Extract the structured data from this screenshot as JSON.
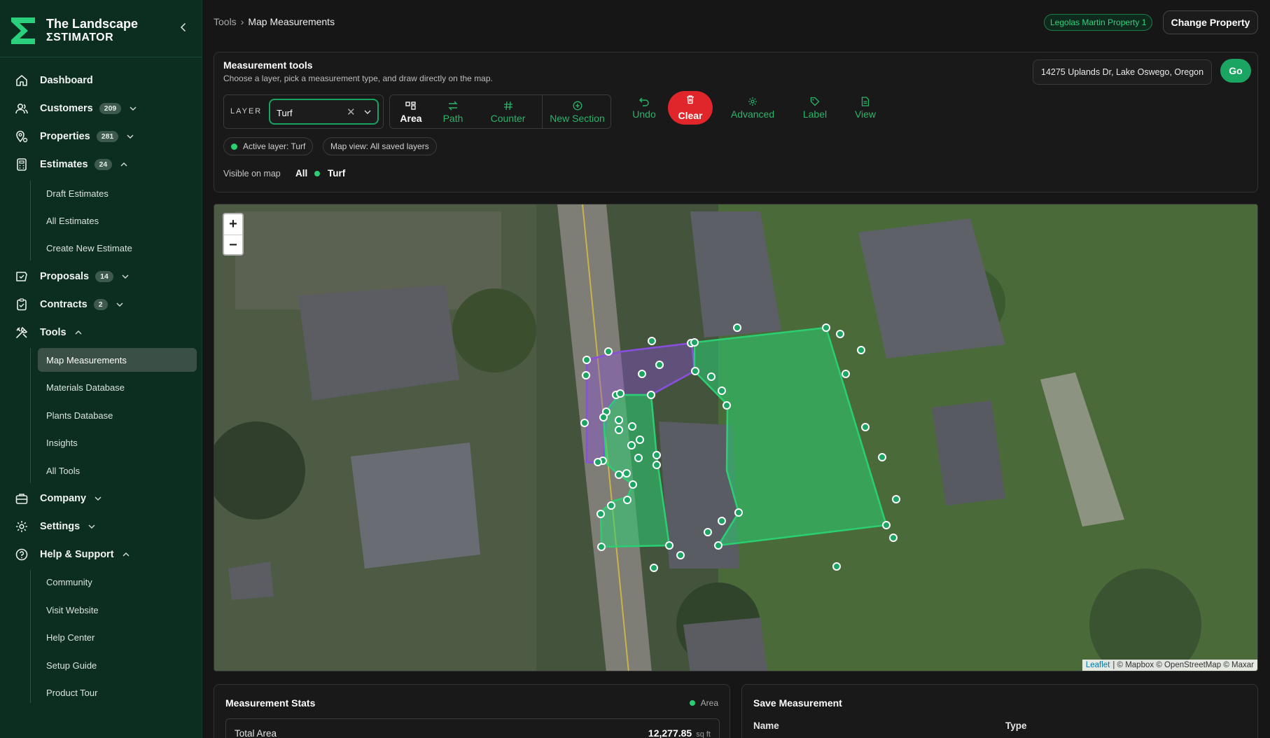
{
  "brand": {
    "line1": "The Landscape",
    "line2": "ΣSTIMATOR",
    "collapse_icon": "‹"
  },
  "nav": {
    "dashboard": {
      "label": "Dashboard"
    },
    "customers": {
      "label": "Customers",
      "badge": "209"
    },
    "properties": {
      "label": "Properties",
      "badge": "281"
    },
    "estimates": {
      "label": "Estimates",
      "badge": "24"
    },
    "estimates_sub": [
      "Draft Estimates",
      "All Estimates",
      "Create New Estimate"
    ],
    "proposals": {
      "label": "Proposals",
      "badge": "14"
    },
    "contracts": {
      "label": "Contracts",
      "badge": "2"
    },
    "tools": {
      "label": "Tools"
    },
    "tools_sub": [
      "Map Measurements",
      "Materials Database",
      "Plants Database",
      "Insights",
      "All Tools"
    ],
    "company": {
      "label": "Company"
    },
    "settings": {
      "label": "Settings"
    },
    "help": {
      "label": "Help & Support"
    },
    "help_sub": [
      "Community",
      "Visit Website",
      "Help Center",
      "Setup Guide",
      "Product Tour"
    ]
  },
  "breadcrumb": {
    "parent": "Tools",
    "separator": "›",
    "current": "Map Measurements"
  },
  "property_pill": "Legolas Martin Property 1",
  "change_property": "Change Property",
  "tools_panel": {
    "title": "Measurement tools",
    "subtitle": "Choose a layer, pick a measurement type, and draw directly on the map.",
    "address_value": "14275 Uplands Dr, Lake Oswego, Oregon",
    "go": "Go",
    "layer_label": "LAYER",
    "layer_value": "Turf",
    "clear_x": "✕",
    "modes": {
      "area": "Area",
      "path": "Path",
      "counter": "Counter",
      "new_section": "New Section"
    },
    "actions": {
      "undo": "Undo",
      "clear": "Clear",
      "advanced": "Advanced",
      "label": "Label",
      "view": "View"
    },
    "chip_active": "Active layer: Turf",
    "chip_view": "Map view: All saved layers",
    "visible_label": "Visible on map",
    "visible_all": "All",
    "visible_turf": "Turf",
    "accent": "#1aa562",
    "area_color": "#2bcf73",
    "purple_color": "#8b4fe0"
  },
  "map": {
    "zoom_in": "+",
    "zoom_out": "−",
    "attribution_link": "Leaflet",
    "attribution_text": "| © Mapbox © OpenStreetMap © Maxar"
  },
  "stats": {
    "title": "Measurement Stats",
    "legend": "Area",
    "total_label": "Total Area",
    "total_value": "12,277.85",
    "total_unit": "sq ft"
  },
  "save": {
    "title": "Save Measurement",
    "name_label": "Name",
    "type_label": "Type"
  }
}
